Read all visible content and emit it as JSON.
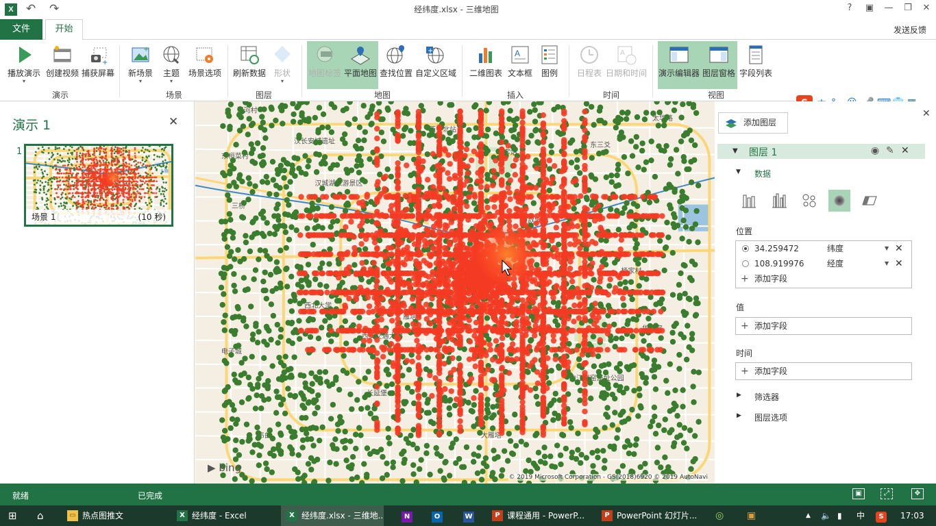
{
  "window": {
    "title": "经纬度.xlsx - 三维地图",
    "app_icon": "X",
    "help": "?",
    "controls": [
      "▣",
      "—",
      "❐",
      "✕"
    ]
  },
  "tabs": {
    "file": "文件",
    "home": "开始",
    "feedback": "发送反馈"
  },
  "ribbon": {
    "buttons": {
      "play_tour": "播放演示",
      "create_video": "创建视频",
      "capture_screen": "捕获屏幕",
      "new_scene": "新场景",
      "theme": "主题",
      "scene_options": "场景选项",
      "refresh_data": "刷新数据",
      "shapes": "形状",
      "map_labels": "地图标签",
      "flat_map": "平面地图",
      "find_location": "查找位置",
      "custom_regions": "自定义区域",
      "2d_chart": "二维图表",
      "text_box": "文本框",
      "legend": "图例",
      "time_line": "日程表",
      "date_time": "日期和时间",
      "tour_editor": "演示编辑器",
      "layer_pane": "图层窗格",
      "field_list": "字段列表"
    },
    "groups": {
      "tour": "演示",
      "scene": "场景",
      "layer": "图层",
      "map": "地图",
      "insert": "插入",
      "time": "时间",
      "view": "视图"
    }
  },
  "tour_pane": {
    "title": "演示 1",
    "close": "✕",
    "scene_number": "1",
    "scene_label": "场景 1",
    "scene_duration": "(10 秒)"
  },
  "map": {
    "provider": "bing",
    "copyright": "© 2019 Microsoft Corporation - GS(2018)6920  © 2019 AutoNavi",
    "places": [
      "泥河村",
      "汉长安城遗址",
      "东桓菜村",
      "汉城湖旅游景区",
      "三桥",
      "西安北站",
      "北客站",
      "太华路",
      "白鹿园",
      "西安",
      "曲江寒窑遗址公园",
      "华清宫",
      "西北大学",
      "西安交通大学",
      "电子城",
      "长延堡",
      "大雁塔",
      "韦曲",
      "赵家村",
      "杨家村",
      "雁塔",
      "东三爻"
    ],
    "colors": {
      "land": "#f4efe2",
      "major_road": "#fbd777",
      "secondary_road": "#ffffff",
      "water": "#9cc3df",
      "river": "#3f88c5",
      "park": "#d6e8c9",
      "point_green": "#3a7d2f",
      "point_red": "#f53b24"
    }
  },
  "layer_pane": {
    "add_layer": "添加图层",
    "layer_name": "图层 1",
    "data_section": "数据",
    "location_label": "位置",
    "location_fields": [
      {
        "value": "34.259472",
        "type": "纬度",
        "selected": true
      },
      {
        "value": "108.919976",
        "type": "经度",
        "selected": false
      }
    ],
    "add_field": "添加字段",
    "value_label": "值",
    "time_label": "时间",
    "filter": "筛选器",
    "layer_options": "图层选项",
    "chart_types": [
      "stacked-column-icon",
      "clustered-column-icon",
      "bubble-icon",
      "heat-map-icon",
      "region-icon"
    ],
    "selected_chart_type": "heat-map-icon"
  },
  "ime": {
    "items": [
      "中",
      "°,",
      "☺",
      "🎤",
      "⌨",
      "👕",
      "▦"
    ]
  },
  "statusbar": {
    "ready": "就绪",
    "done": "已完成"
  },
  "taskbar": {
    "items": [
      {
        "label": "热点图推文",
        "icon": "folder-icon"
      },
      {
        "label": "经纬度 - Excel",
        "icon": "excel-icon"
      },
      {
        "label": "经纬度.xlsx - 三维地...",
        "icon": "excel-icon",
        "active": true
      },
      {
        "label": "课程通用 - PowerP...",
        "icon": "powerpoint-icon"
      },
      {
        "label": "PowerPoint 幻灯片...",
        "icon": "powerpoint-icon"
      }
    ],
    "ime_lang": "中",
    "time": "17:03"
  }
}
